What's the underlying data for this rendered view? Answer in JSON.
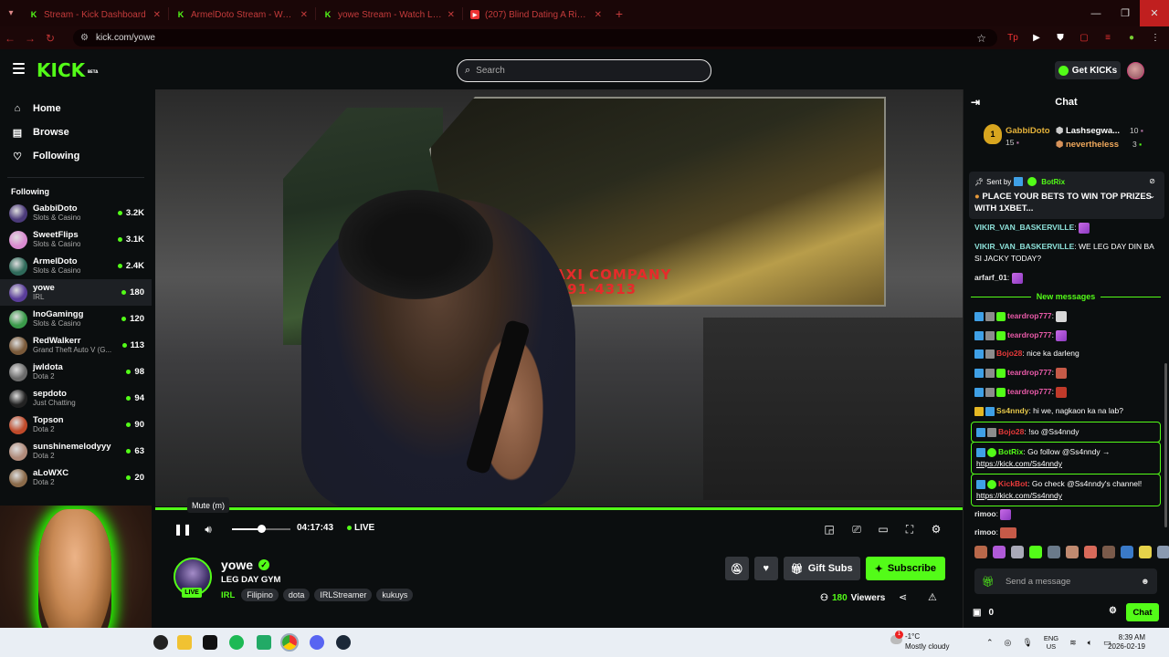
{
  "browser": {
    "tabs": [
      {
        "title": "Stream - Kick Dashboard",
        "icon": "kick"
      },
      {
        "title": "ArmelDoto Stream - Watch Liv",
        "icon": "kick"
      },
      {
        "title": "yowe Stream - Watch Live",
        "icon": "kick"
      },
      {
        "title": "(207) Blind Dating A Rich Guy",
        "icon": "youtube"
      }
    ],
    "url": "kick.com/yowe"
  },
  "header": {
    "logo": "KICK",
    "logo_sup": "BETA",
    "search_placeholder": "Search",
    "get_kicks": "Get KICKs"
  },
  "sidebar": {
    "nav": [
      {
        "label": "Home",
        "icon": "home-icon"
      },
      {
        "label": "Browse",
        "icon": "browse-icon"
      },
      {
        "label": "Following",
        "icon": "heart-icon"
      }
    ],
    "following_heading": "Following",
    "channels": [
      {
        "name": "GabbiDoto",
        "category": "Slots & Casino",
        "viewers": "3.2K",
        "color": "#4b3a7a"
      },
      {
        "name": "SweetFlips",
        "category": "Slots & Casino",
        "viewers": "3.1K",
        "color": "#d98ad0"
      },
      {
        "name": "ArmelDoto",
        "category": "Slots & Casino",
        "viewers": "2.4K",
        "color": "#2f6a5a"
      },
      {
        "name": "yowe",
        "category": "IRL",
        "viewers": "180",
        "color": "#5a3d9a"
      },
      {
        "name": "InoGamingg",
        "category": "Slots & Casino",
        "viewers": "120",
        "color": "#3a9a4a"
      },
      {
        "name": "RedWalkerr",
        "category": "Grand Theft Auto V (G...",
        "viewers": "113",
        "color": "#7a5a3a"
      },
      {
        "name": "jwldota",
        "category": "Dota 2",
        "viewers": "98",
        "color": "#6a6a6a"
      },
      {
        "name": "sepdoto",
        "category": "Just Chatting",
        "viewers": "94",
        "color": "#222"
      },
      {
        "name": "Topson",
        "category": "Dota 2",
        "viewers": "90",
        "color": "#c04a2a"
      },
      {
        "name": "sunshinemelodyyy",
        "category": "Dota 2",
        "viewers": "63",
        "color": "#b08a7a"
      },
      {
        "name": "aLoWXC",
        "category": "Dota 2",
        "viewers": "20",
        "color": "#8a6a4a"
      }
    ]
  },
  "video": {
    "taxi_line1": "HOH TAXI COMPANY",
    "taxi_line2": "TEL #:491-4313",
    "tooltip": "Mute (m)",
    "time": "04:17:43",
    "live": "LIVE",
    "volume_fraction": 0.5
  },
  "stream": {
    "name": "yowe",
    "title": "LEG DAY GYM",
    "live_badge": "LIVE",
    "category": "IRL",
    "tags": [
      "Filipino",
      "dota",
      "IRLStreamer",
      "kukuys"
    ],
    "gift_subs": "Gift Subs",
    "subscribe": "Subscribe",
    "viewers_count": "180",
    "viewers_label": "Viewers"
  },
  "chat": {
    "title": "Chat",
    "leaderboard": [
      {
        "name": "GabbiDoto",
        "count": "15"
      },
      {
        "name": "Lashsegwa...",
        "count": "10"
      },
      {
        "name": "nevertheless",
        "count": "3"
      }
    ],
    "pinned_by_label": "Sent by",
    "pinned_by": "BotRix",
    "pinned_text": "PLACE YOUR BETS TO WIN TOP PRIZES WITH 1XBET...",
    "messages_before": [
      {
        "user": "VIKIR_VAN_BASKERVILLE",
        "text": "",
        "emote": true
      },
      {
        "user": "VIKIR_VAN_BASKERVILLE",
        "text": "WE LEG DAY DIN BA SI JACKY TODAY?",
        "emote": false
      },
      {
        "user": "arfarf_01",
        "text": "",
        "emote": true
      }
    ],
    "new_messages_label": "New messages",
    "messages_after": [
      {
        "user": "teardrop777",
        "text": ""
      },
      {
        "user": "teardrop777",
        "text": ""
      },
      {
        "user": "Bojo28",
        "text": "nice ka darleng"
      },
      {
        "user": "teardrop777",
        "text": ""
      },
      {
        "user": "teardrop777",
        "text": ""
      },
      {
        "user": "Ss4nndy",
        "text": "hi we, nagkaon ka na lab?"
      }
    ],
    "boxed_messages": [
      {
        "user": "Bojo28",
        "text": "!so @Ss4nndy"
      },
      {
        "user": "BotRix",
        "text": "Go follow @Ss4nndy →",
        "link": "https://kick.com/Ss4nndy"
      },
      {
        "user": "KickBot",
        "text": "Go check @Ss4nndy's channel!",
        "link": "https://kick.com/Ss4nndy"
      }
    ],
    "messages_end": [
      {
        "user": "rimoo",
        "text": ""
      },
      {
        "user": "rimoo",
        "text": ""
      }
    ],
    "input_placeholder": "Send a message",
    "footer_count": "0",
    "send_label": "Chat"
  },
  "taskbar": {
    "weather_temp": "-1°C",
    "weather_desc": "Mostly cloudy",
    "weather_badge": "1",
    "lang1": "ENG",
    "lang2": "US",
    "time": "8:39 AM",
    "date": "2026-02-19"
  },
  "colors": {
    "kick_green": "#53fc18",
    "browser_red": "#c43b3b",
    "bg": "#0b0e0f"
  }
}
